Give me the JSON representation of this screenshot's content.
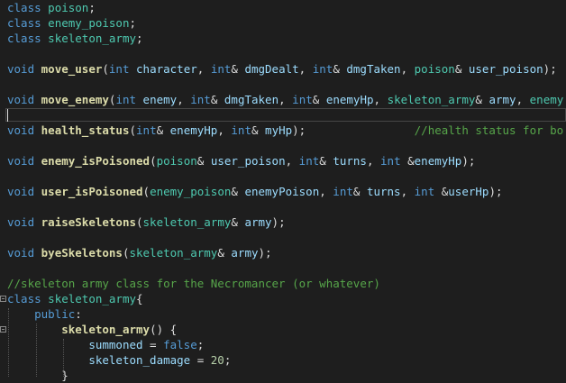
{
  "editor": {
    "lines": [
      [
        [
          "kw",
          "class"
        ],
        [
          "txt",
          " "
        ],
        [
          "cls",
          "poison"
        ],
        [
          "txt",
          ";"
        ]
      ],
      [
        [
          "kw",
          "class"
        ],
        [
          "txt",
          " "
        ],
        [
          "cls",
          "enemy_poison"
        ],
        [
          "txt",
          ";"
        ]
      ],
      [
        [
          "kw",
          "class"
        ],
        [
          "txt",
          " "
        ],
        [
          "cls",
          "skeleton_army"
        ],
        [
          "txt",
          ";"
        ]
      ],
      [],
      [
        [
          "kw",
          "void"
        ],
        [
          "txt",
          " "
        ],
        [
          "fn",
          "move_user"
        ],
        [
          "txt",
          "("
        ],
        [
          "kw",
          "int"
        ],
        [
          "txt",
          " "
        ],
        [
          "id",
          "character"
        ],
        [
          "txt",
          ", "
        ],
        [
          "kw",
          "int"
        ],
        [
          "txt",
          "& "
        ],
        [
          "id",
          "dmgDealt"
        ],
        [
          "txt",
          ", "
        ],
        [
          "kw",
          "int"
        ],
        [
          "txt",
          "& "
        ],
        [
          "id",
          "dmgTaken"
        ],
        [
          "txt",
          ", "
        ],
        [
          "cls",
          "poison"
        ],
        [
          "txt",
          "& "
        ],
        [
          "id",
          "user_poison"
        ],
        [
          "txt",
          ");"
        ]
      ],
      [],
      [
        [
          "kw",
          "void"
        ],
        [
          "txt",
          " "
        ],
        [
          "fn",
          "move_enemy"
        ],
        [
          "txt",
          "("
        ],
        [
          "kw",
          "int"
        ],
        [
          "txt",
          " "
        ],
        [
          "id",
          "enemy"
        ],
        [
          "txt",
          ", "
        ],
        [
          "kw",
          "int"
        ],
        [
          "txt",
          "& "
        ],
        [
          "id",
          "dmgTaken"
        ],
        [
          "txt",
          ", "
        ],
        [
          "kw",
          "int"
        ],
        [
          "txt",
          "& "
        ],
        [
          "id",
          "enemyHp"
        ],
        [
          "txt",
          ", "
        ],
        [
          "cls",
          "skeleton_army"
        ],
        [
          "txt",
          "& "
        ],
        [
          "id",
          "army"
        ],
        [
          "txt",
          ", "
        ],
        [
          "cls",
          "enemy"
        ]
      ],
      [],
      [
        [
          "kw",
          "void"
        ],
        [
          "txt",
          " "
        ],
        [
          "fn",
          "health_status"
        ],
        [
          "txt",
          "("
        ],
        [
          "kw",
          "int"
        ],
        [
          "txt",
          "& "
        ],
        [
          "id",
          "enemyHp"
        ],
        [
          "txt",
          ", "
        ],
        [
          "kw",
          "int"
        ],
        [
          "txt",
          "& "
        ],
        [
          "id",
          "myHp"
        ],
        [
          "txt",
          ");"
        ],
        [
          "txt",
          "                "
        ],
        [
          "cm",
          "//health status for bo"
        ]
      ],
      [],
      [
        [
          "kw",
          "void"
        ],
        [
          "txt",
          " "
        ],
        [
          "fn",
          "enemy_isPoisoned"
        ],
        [
          "txt",
          "("
        ],
        [
          "cls",
          "poison"
        ],
        [
          "txt",
          "& "
        ],
        [
          "id",
          "user_poison"
        ],
        [
          "txt",
          ", "
        ],
        [
          "kw",
          "int"
        ],
        [
          "txt",
          "& "
        ],
        [
          "id",
          "turns"
        ],
        [
          "txt",
          ", "
        ],
        [
          "kw",
          "int"
        ],
        [
          "txt",
          " &"
        ],
        [
          "id",
          "enemyHp"
        ],
        [
          "txt",
          ");"
        ]
      ],
      [],
      [
        [
          "kw",
          "void"
        ],
        [
          "txt",
          " "
        ],
        [
          "fn",
          "user_isPoisoned"
        ],
        [
          "txt",
          "("
        ],
        [
          "cls",
          "enemy_poison"
        ],
        [
          "txt",
          "& "
        ],
        [
          "id",
          "enemyPoison"
        ],
        [
          "txt",
          ", "
        ],
        [
          "kw",
          "int"
        ],
        [
          "txt",
          "& "
        ],
        [
          "id",
          "turns"
        ],
        [
          "txt",
          ", "
        ],
        [
          "kw",
          "int"
        ],
        [
          "txt",
          " &"
        ],
        [
          "id",
          "userHp"
        ],
        [
          "txt",
          ");"
        ]
      ],
      [],
      [
        [
          "kw",
          "void"
        ],
        [
          "txt",
          " "
        ],
        [
          "fn",
          "raiseSkeletons"
        ],
        [
          "txt",
          "("
        ],
        [
          "cls",
          "skeleton_army"
        ],
        [
          "txt",
          "& "
        ],
        [
          "id",
          "army"
        ],
        [
          "txt",
          ");"
        ]
      ],
      [],
      [
        [
          "kw",
          "void"
        ],
        [
          "txt",
          " "
        ],
        [
          "fn",
          "byeSkeletons"
        ],
        [
          "txt",
          "("
        ],
        [
          "cls",
          "skeleton_army"
        ],
        [
          "txt",
          "& "
        ],
        [
          "id",
          "army"
        ],
        [
          "txt",
          ");"
        ]
      ],
      [],
      [
        [
          "cm",
          "//skeleton army class for the Necromancer (or whatever)"
        ]
      ],
      [
        [
          "kw",
          "class"
        ],
        [
          "txt",
          " "
        ],
        [
          "cls",
          "skeleton_army"
        ],
        [
          "txt",
          "{"
        ]
      ],
      [
        [
          "txt",
          "    "
        ],
        [
          "kw",
          "public"
        ],
        [
          "txt",
          ":"
        ]
      ],
      [
        [
          "txt",
          "        "
        ],
        [
          "fn",
          "skeleton_army"
        ],
        [
          "txt",
          "() {"
        ]
      ],
      [
        [
          "txt",
          "            "
        ],
        [
          "id",
          "summoned"
        ],
        [
          "txt",
          " = "
        ],
        [
          "kw",
          "false"
        ],
        [
          "txt",
          ";"
        ]
      ],
      [
        [
          "txt",
          "            "
        ],
        [
          "id",
          "skeleton_damage"
        ],
        [
          "txt",
          " = "
        ],
        [
          "num",
          "20"
        ],
        [
          "txt",
          ";"
        ]
      ],
      [
        [
          "txt",
          "        }"
        ]
      ]
    ]
  }
}
